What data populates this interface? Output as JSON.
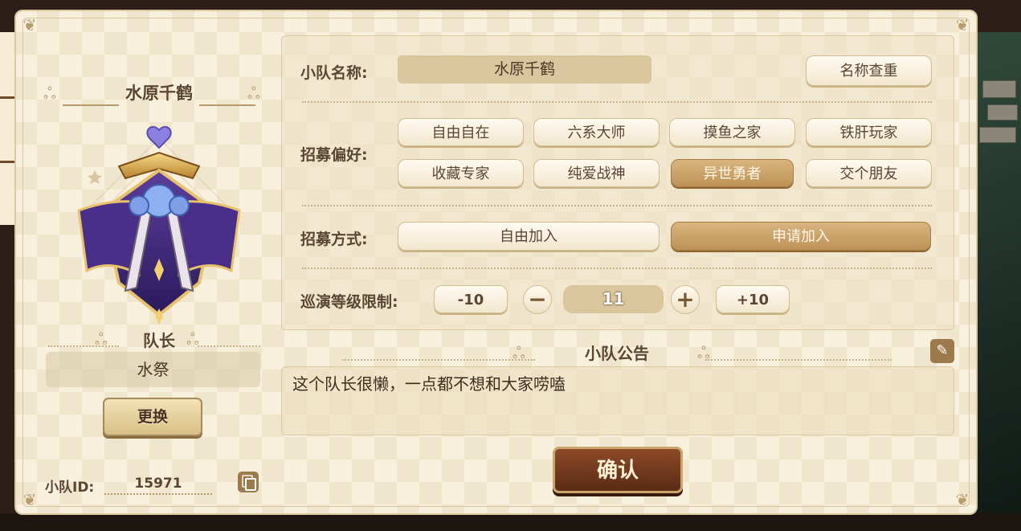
{
  "team": {
    "display_name": "水原千鹤",
    "captain_label": "队长",
    "captain_name": "水祭",
    "change_button": "更换",
    "id_label": "小队ID:",
    "id_value": "15971"
  },
  "form": {
    "name_label": "小队名称:",
    "name_value": "水原千鹤",
    "check_name_button": "名称查重",
    "preference_label": "招募偏好:",
    "preferences": [
      {
        "label": "自由自在",
        "selected": false
      },
      {
        "label": "六系大师",
        "selected": false
      },
      {
        "label": "摸鱼之家",
        "selected": false
      },
      {
        "label": "铁肝玩家",
        "selected": false
      },
      {
        "label": "收藏专家",
        "selected": false
      },
      {
        "label": "纯爱战神",
        "selected": false
      },
      {
        "label": "异世勇者",
        "selected": true
      },
      {
        "label": "交个朋友",
        "selected": false
      }
    ],
    "method_label": "招募方式:",
    "methods": [
      {
        "label": "自由加入",
        "selected": false
      },
      {
        "label": "申请加入",
        "selected": true
      }
    ],
    "level_label": "巡演等级限制:",
    "level_minus10": "-10",
    "level_minus": "−",
    "level_value": "11",
    "level_plus": "+",
    "level_plus10": "+10"
  },
  "notice": {
    "title": "小队公告",
    "text": "这个队长很懒，一点都不想和大家唠嗑"
  },
  "confirm_button": "确认",
  "colors": {
    "panel_bg": "#f7f0dc",
    "accent_gold": "#bd9257",
    "confirm_brown": "#6e3519",
    "text_brown": "#5a4632"
  }
}
